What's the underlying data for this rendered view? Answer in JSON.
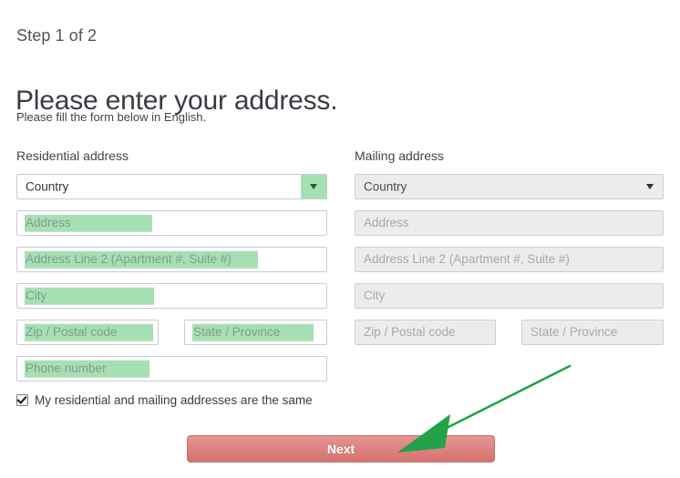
{
  "header": {
    "step_label": "Step 1 of 2",
    "title": "Please enter your address.",
    "subtitle": "Please fill the form below in English."
  },
  "residential": {
    "heading": "Residential address",
    "country_value": "Country",
    "fields": {
      "address": "Address",
      "address2": "Address Line 2 (Apartment #, Suite #)",
      "city": "City",
      "zip": "Zip / Postal code",
      "state": "State / Province",
      "phone": "Phone number"
    }
  },
  "mailing": {
    "heading": "Mailing address",
    "country_value": "Country",
    "fields": {
      "address": "Address",
      "address2": "Address Line 2 (Apartment #, Suite #)",
      "city": "City",
      "zip": "Zip / Postal code",
      "state": "State / Province"
    }
  },
  "same_address": {
    "label": "My residential and mailing addresses are the same",
    "checked": "true"
  },
  "actions": {
    "next_label": "Next"
  },
  "annotation": {
    "arrow_color": "#22a34a",
    "arrow_tail_x": "625",
    "arrow_tail_y": "402",
    "arrow_tip_x": "436",
    "arrow_tip_y": "497"
  },
  "colors": {
    "selection_green": "#a7dfb5",
    "button_red": "#dd817e",
    "disabled_grey": "#ececec",
    "placeholder_grey": "#a7a7a7",
    "arrow_green": "#22a34a"
  }
}
